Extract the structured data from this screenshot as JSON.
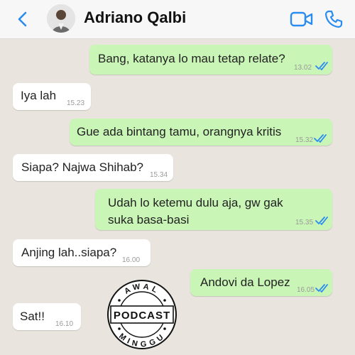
{
  "header": {
    "contact_name": "Adriano Qalbi",
    "back_icon": "chevron-left-icon",
    "video_icon": "video-camera-icon",
    "call_icon": "phone-icon",
    "accent_color": "#2a8cf0"
  },
  "messages": [
    {
      "side": "out",
      "text": "Bang, katanya lo mau tetap relate?",
      "time": "13.02"
    },
    {
      "side": "in",
      "text": "Iya lah",
      "time": "15.23"
    },
    {
      "side": "out",
      "text": "Gue ada bintang tamu, orangnya kritis",
      "time": "15.32"
    },
    {
      "side": "in",
      "text": "Siapa? Najwa Shihab?",
      "time": "15.34"
    },
    {
      "side": "out",
      "text": "Udah lo ketemu dulu aja, gw gak suka basa-basi",
      "time": "15.35"
    },
    {
      "side": "in",
      "text": "Anjing lah..siapa?",
      "time": "16.00"
    },
    {
      "side": "out",
      "text": "Andovi da Lopez",
      "time": "16.05"
    },
    {
      "side": "in",
      "text": "Sat!!",
      "time": "16.10"
    }
  ],
  "badge": {
    "top": "AWAL",
    "middle": "PODCAST",
    "bottom": "MINGGU"
  },
  "colors": {
    "background": "#e9e5de",
    "incoming_bubble": "#ffffff",
    "outgoing_bubble": "#c9f5b6",
    "read_ticks": "#2a8cf0"
  }
}
